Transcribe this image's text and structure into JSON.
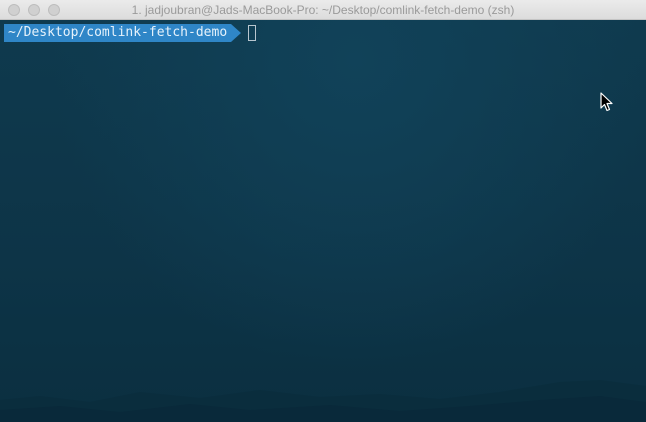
{
  "window": {
    "title": "1. jadjoubran@Jads-MacBook-Pro: ~/Desktop/comlink-fetch-demo (zsh)"
  },
  "terminal": {
    "prompt_path": "~/Desktop/comlink-fetch-demo",
    "command": "",
    "prompt_color": "#2f86c7",
    "background_color": "#0d3447"
  },
  "icons": {
    "close": "close-icon",
    "minimize": "minimize-icon",
    "zoom": "zoom-icon",
    "pointer": "mouse-pointer-icon"
  }
}
